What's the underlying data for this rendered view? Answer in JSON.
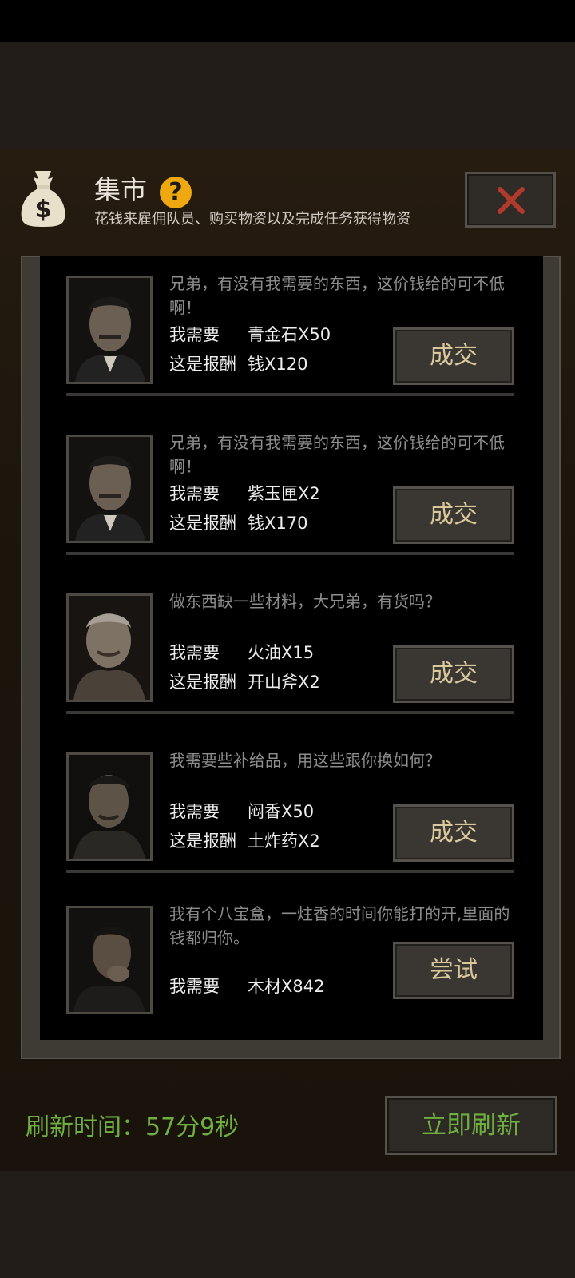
{
  "header": {
    "title": "集市",
    "help_glyph": "?",
    "subtitle": "花钱来雇佣队员、购买物资以及完成任务获得物资"
  },
  "colors": {
    "accent_green": "#6fae40",
    "help_yellow": "#f0a810",
    "close_red": "#b13a2c",
    "button_text": "#d9c89c"
  },
  "trades": [
    {
      "dialogue": "兄弟，有没有我需要的东西，这价钱给的可不低啊！",
      "need_label": "我需要",
      "need_value": "青金石X50",
      "reward_label": "这是报酬",
      "reward_value": "钱X120",
      "button": "成交",
      "portrait": "man-mustache-portrait"
    },
    {
      "dialogue": "兄弟，有没有我需要的东西，这价钱给的可不低啊！",
      "need_label": "我需要",
      "need_value": "紫玉匣X2",
      "reward_label": "这是报酬",
      "reward_value": "钱X170",
      "button": "成交",
      "portrait": "man-mustache-portrait"
    },
    {
      "dialogue": "做东西缺一些材料，大兄弟，有货吗？",
      "need_label": "我需要",
      "need_value": "火油X15",
      "reward_label": "这是报酬",
      "reward_value": "开山斧X2",
      "button": "成交",
      "portrait": "old-man-portrait"
    },
    {
      "dialogue": "我需要些补给品，用这些跟你换如何？",
      "need_label": "我需要",
      "need_value": "闷香X50",
      "reward_label": "这是报酬",
      "reward_value": "土炸药X2",
      "button": "成交",
      "portrait": "rough-man-portrait"
    },
    {
      "dialogue": "我有个八宝盒，一炷香的时间你能打的开,里面的钱都归你。",
      "need_label": "我需要",
      "need_value": "木材X842",
      "button": "尝试",
      "portrait": "young-man-portrait"
    }
  ],
  "footer": {
    "refresh_time": "刷新时间：57分9秒",
    "refresh_button": "立即刷新"
  }
}
